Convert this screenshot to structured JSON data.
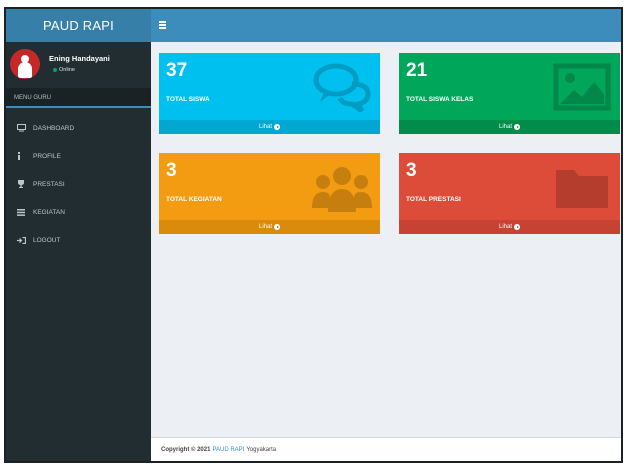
{
  "app": {
    "brand": "PAUD RAPI"
  },
  "user": {
    "name": "Ening Handayani",
    "status": "Online"
  },
  "sidebar": {
    "header": "MENU GURU",
    "items": [
      {
        "label": "DASHBOARD",
        "icon": "monitor-icon"
      },
      {
        "label": "PROFILE",
        "icon": "info-icon"
      },
      {
        "label": "PRESTASI",
        "icon": "trophy-icon"
      },
      {
        "label": "KEGIATAN",
        "icon": "list-icon"
      },
      {
        "label": "LOGOUT",
        "icon": "logout-icon"
      }
    ]
  },
  "boxes": [
    {
      "count": "37",
      "label": "TOTAL SISWA",
      "link": "Lihat",
      "icon": "comments-icon",
      "color": "#00c0ef"
    },
    {
      "count": "21",
      "label": "TOTAL SISWA KELAS",
      "link": "Lihat",
      "icon": "image-icon",
      "color": "#00a65a"
    },
    {
      "count": "3",
      "label": "TOTAL KEGIATAN",
      "link": "Lihat",
      "icon": "users-icon",
      "color": "#f39c12"
    },
    {
      "count": "3",
      "label": "TOTAL PRESTASI",
      "link": "Lihat",
      "icon": "folder-icon",
      "color": "#dd4b39"
    }
  ],
  "footer": {
    "prefix": "Copyright © 2021",
    "brand": "PAUD RAPI",
    "suffix": "Yogyakarta"
  }
}
